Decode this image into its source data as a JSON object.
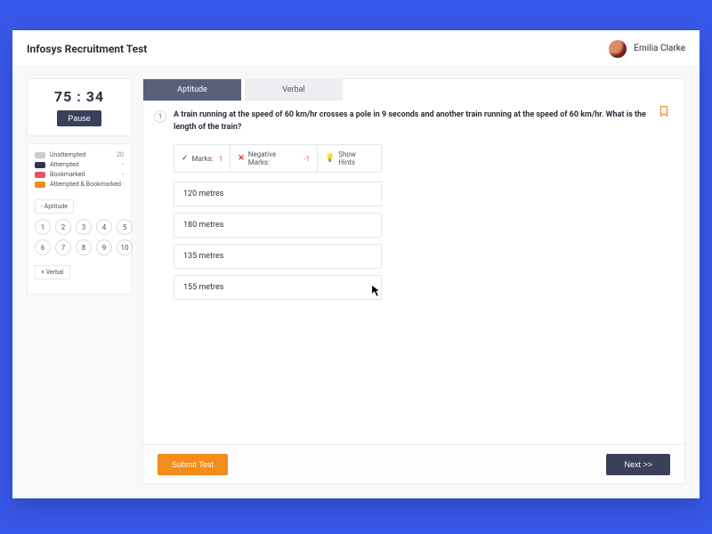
{
  "header": {
    "title": "Infosys Recruitment Test",
    "user_name": "Emilia Clarke"
  },
  "timer": {
    "display": "75 : 34",
    "pause_label": "Pause"
  },
  "legend": {
    "unattempted": {
      "label": "Unattempted",
      "count": "20"
    },
    "attempted": {
      "label": "Attempted",
      "count": "-"
    },
    "bookmarked": {
      "label": "Bookmarked",
      "count": "-"
    },
    "attempted_bookmarked": {
      "label": "Attempted & Bookmarked",
      "count": "-"
    }
  },
  "sections": {
    "aptitude": {
      "toggle": "-  Aptitude",
      "numbers": [
        "1",
        "2",
        "3",
        "4",
        "5",
        "6",
        "7",
        "8",
        "9",
        "10"
      ]
    },
    "verbal": {
      "toggle": "+  Verbal"
    }
  },
  "tabs": {
    "aptitude": "Aptitude",
    "verbal": "Verbal"
  },
  "question": {
    "number": "1",
    "text": "A train running at the speed of 60 km/hr crosses a pole in 9 seconds and another train running at the speed of 60 km/hr. What is the length of the train?",
    "marks_label": "Marks:",
    "marks_value": "1",
    "neg_label": "Negative Marks:",
    "neg_value": "-1",
    "hints_label": "Show Hints",
    "options": [
      "120 metres",
      "180 metres",
      "135 metres",
      "155 metres"
    ]
  },
  "footer": {
    "submit": "Submit Test",
    "next": "Next >>"
  },
  "colors": {
    "accent_blue": "#3858e9",
    "orange": "#f28c1a",
    "dark": "#3a3f5a"
  }
}
